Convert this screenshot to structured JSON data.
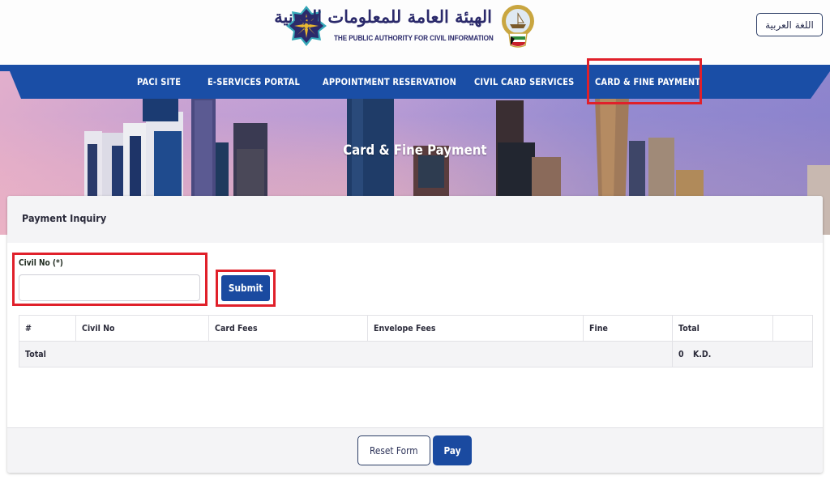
{
  "header": {
    "logo_arabic": "الهيئة العامة للمعلومات المدنية",
    "logo_english": "THE PUBLIC AUTHORITY FOR CIVIL INFORMATION",
    "language_button": "اللغة العربية"
  },
  "nav": {
    "items": [
      {
        "label": "PACI SITE"
      },
      {
        "label": "E-SERVICES PORTAL"
      },
      {
        "label": "APPOINTMENT RESERVATION"
      },
      {
        "label": "CIVIL CARD SERVICES"
      },
      {
        "label": "CARD & FINE PAYMENT",
        "highlighted": true
      }
    ],
    "bar_color": "#1a4ea6"
  },
  "hero": {
    "title": "Card & Fine Payment"
  },
  "form": {
    "section_title": "Payment Inquiry",
    "civil_no_label": "Civil No (*)",
    "civil_no_value": "",
    "civil_no_placeholder": "",
    "submit_label": "Submit"
  },
  "table": {
    "columns": [
      "#",
      "Civil No",
      "Card Fees",
      "Envelope Fees",
      "Fine",
      "Total",
      ""
    ],
    "total_row": {
      "label": "Total",
      "amount": "0",
      "currency": "K.D."
    }
  },
  "footer": {
    "reset_label": "Reset Form",
    "pay_label": "Pay"
  },
  "colors": {
    "primary": "#1a4aa0",
    "highlight": "#e0202a"
  }
}
